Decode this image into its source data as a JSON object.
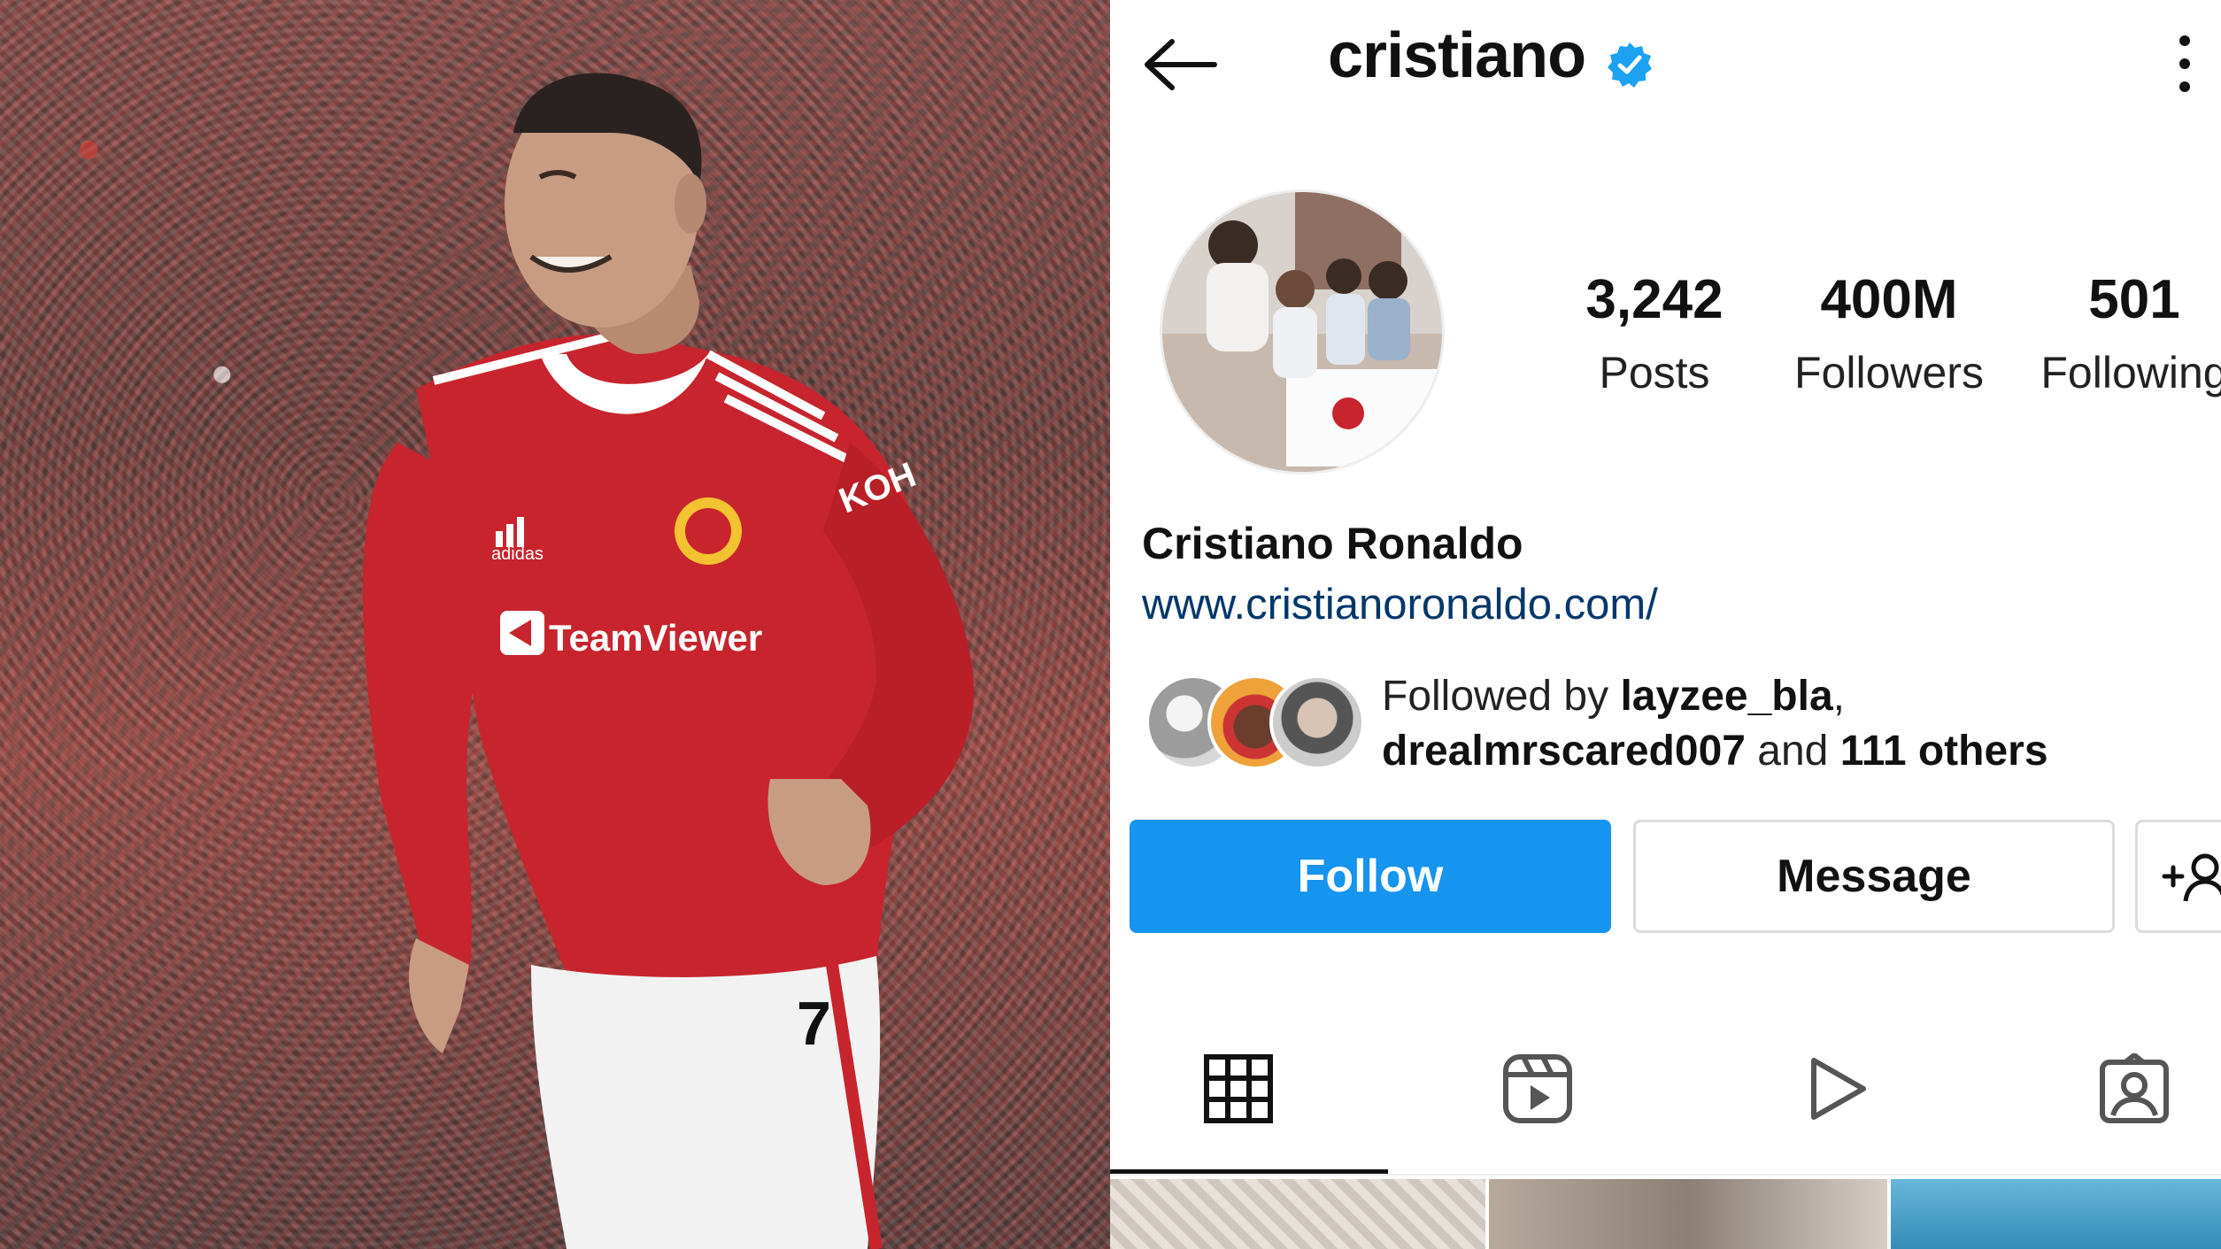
{
  "profile": {
    "username": "cristiano",
    "full_name": "Cristiano Ronaldo",
    "website": "www.cristianoronaldo.com/"
  },
  "stats": {
    "posts": {
      "value": "3,242",
      "label": "Posts"
    },
    "followers": {
      "value": "400M",
      "label": "Followers"
    },
    "following": {
      "value": "501",
      "label": "Following"
    }
  },
  "followed_by": {
    "prefix": "Followed by ",
    "user1": "layzee_bla",
    "sep": ",",
    "user2": "drealmrscared007",
    "and": " and ",
    "others": "111 others"
  },
  "buttons": {
    "follow": "Follow",
    "message": "Message"
  },
  "photo": {
    "jersey_sponsor": "TeamViewer",
    "sleeve_sponsor": "KOH",
    "kit_brand": "adidas",
    "shirt_number": "7"
  },
  "icons": {
    "back": "arrow-left-icon",
    "verified": "verified-badge-icon",
    "more": "more-vertical-icon",
    "suggest": "add-user-icon",
    "tabs": [
      "grid-icon",
      "reels-icon",
      "video-icon",
      "tagged-icon"
    ]
  },
  "colors": {
    "accent": "#1594f0",
    "link": "#00376b",
    "verified": "#1da1f2",
    "jersey_red": "#c8242d"
  }
}
